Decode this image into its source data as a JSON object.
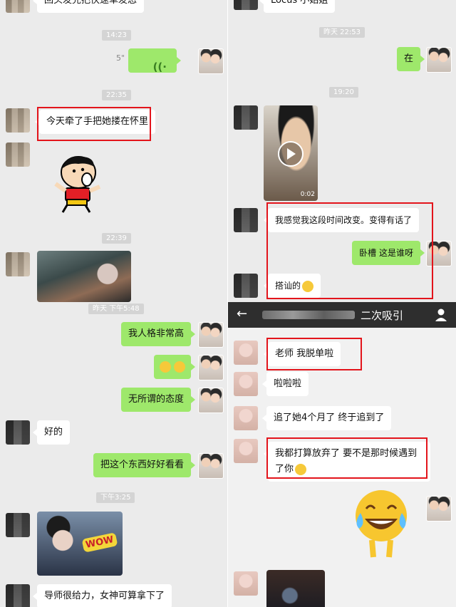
{
  "left": {
    "top_partial_text": "回头发完把快速草发怂",
    "timestamps": [
      "14:23",
      "22:35",
      "22:39",
      "昨天 下午5:48",
      "下午3:25"
    ],
    "voice": {
      "duration": "5\""
    },
    "messages": {
      "m1": "今天牵了手把她搂在怀里",
      "m2": "我人格非常高",
      "m3": "无所谓的态度",
      "m4": "好的",
      "m5": "把这个东西好好看看",
      "m6": "导师很给力，女神可算拿下了"
    },
    "sticker_wow": "WOW"
  },
  "right_top": {
    "top_partial_text": "Locus 小姑姐",
    "timestamps": [
      "昨天 22:53",
      "19:20"
    ],
    "messages": {
      "m1": "在",
      "m2": "我感觉我这段时间改变。变得有话了",
      "m3": "卧槽 这是谁呀",
      "m4": "搭讪的"
    },
    "video_duration": "0:02"
  },
  "right_bottom": {
    "header": {
      "title": "二次吸引",
      "back_icon": "arrow-left-icon",
      "profile_icon": "person-icon"
    },
    "messages": {
      "m1": "老师 我脱单啦",
      "m2": "啦啦啦",
      "m3": "追了她4个月了 终于追到了",
      "m4": "我都打算放弃了 要不是那时候遇到了你"
    }
  },
  "colors": {
    "outgoing_bubble": "#9ee86b",
    "incoming_bubble": "#ffffff",
    "highlight_box": "#e3141b",
    "header_bg": "#2e2e2e"
  }
}
